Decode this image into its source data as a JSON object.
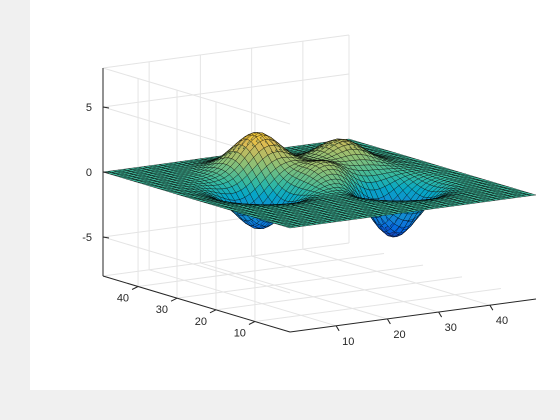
{
  "chart_data": {
    "type": "surface",
    "title": "",
    "xlabel": "",
    "ylabel": "",
    "zlabel": "",
    "grid": true,
    "colormap": "parula",
    "x_range": [
      1,
      49
    ],
    "y_range": [
      1,
      49
    ],
    "zlim": [
      -8,
      8
    ],
    "x_ticks": [
      10,
      20,
      30,
      40
    ],
    "y_ticks": [
      10,
      20,
      30,
      40
    ],
    "z_ticks": [
      -5,
      0,
      5
    ],
    "x_tick_labels": [
      "10",
      "20",
      "30",
      "40"
    ],
    "y_tick_labels": [
      "10",
      "20",
      "30",
      "40"
    ],
    "z_tick_labels": [
      "-5",
      "0",
      "5"
    ],
    "grid_size": 49,
    "features": [
      {
        "kind": "peak",
        "x_center": 22,
        "y_center": 37,
        "amplitude": 3
      },
      {
        "kind": "peak",
        "x_center": 36,
        "y_center": 34,
        "amplitude": 2
      },
      {
        "kind": "peak",
        "x_center": 27,
        "y_center": 26,
        "amplitude": 1.5
      },
      {
        "kind": "valley",
        "x_center": 14,
        "y_center": 26,
        "amplitude": -3
      },
      {
        "kind": "valley",
        "x_center": 34,
        "y_center": 18,
        "amplitude": -4
      }
    ]
  },
  "colors": {
    "figure_background": "#f0f0f0",
    "axes_background": "#ffffff",
    "grid_line": "#e4e4e4",
    "axis_line": "#262626",
    "mesh_edge": "#000000"
  }
}
